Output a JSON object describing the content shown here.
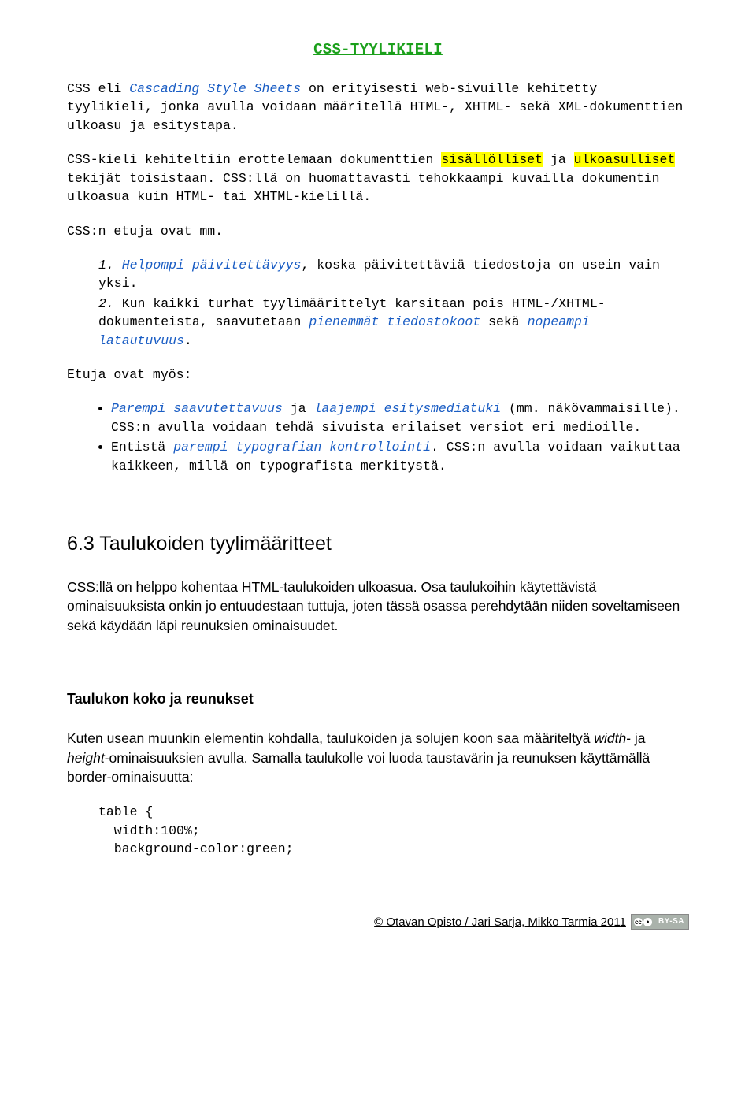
{
  "title": "CSS-TYYLIKIELI",
  "p1": {
    "a": "CSS eli ",
    "b": "Cascading Style Sheets",
    "c": " on erityisesti web-sivuille kehitetty tyylikieli, jonka avulla voidaan määritellä HTML-, XHTML- sekä XML-dokumenttien ulkoasu ja esitystapa."
  },
  "p2": {
    "a": "CSS-kieli kehiteltiin erottelemaan dokumenttien ",
    "b": "sisällölliset",
    "c": " ja ",
    "d": "ulkoasulliset",
    "e": " tekijät toisistaan. CSS:llä on huomattavasti tehokkaampi kuvailla dokumentin ulkoasua kuin HTML- tai XHTML-kielillä."
  },
  "p3": "CSS:n etuja ovat mm.",
  "ol": {
    "n1": "1.",
    "i1a": "Helpompi päivitettävyys",
    "i1b": ", koska päivitettäviä tiedostoja on usein vain yksi.",
    "n2": "2.",
    "i2a": "Kun kaikki turhat tyylimäärittelyt karsitaan pois HTML-/XHTML-dokumenteista, saavutetaan ",
    "i2b": "pienemmät tiedostokoot",
    "i2c": " sekä ",
    "i2d": "nopeampi latautuvuus",
    "i2e": "."
  },
  "p4": "Etuja ovat myös:",
  "ul": {
    "b1a": "Parempi saavutettavuus",
    "b1b": " ja ",
    "b1c": "laajempi esitysmediatuki",
    "b1d": " (mm. näkövammaisille). CSS:n avulla voidaan tehdä sivuista erilaiset versiot eri medioille.",
    "b2a": "Entistä ",
    "b2b": "parempi typografian kontrollointi",
    "b2c": ". CSS:n avulla voidaan vaikuttaa kaikkeen, millä on typografista merkitystä."
  },
  "h2": "6.3 Taulukoiden tyylimääritteet",
  "p5": "CSS:llä on helppo kohentaa HTML-taulukoiden ulkoasua. Osa taulukoihin käytettävistä ominaisuuksista onkin jo entuudestaan tuttuja, joten tässä osassa perehdytään niiden soveltamiseen sekä käydään läpi reunuksien ominaisuudet.",
  "h3": "Taulukon koko ja reunukset",
  "p6": {
    "a": "Kuten usean muunkin elementin kohdalla, taulukoiden ja solujen koon saa määriteltyä ",
    "b": "width",
    "c": "- ja ",
    "d": "height",
    "e": "-ominaisuuksien avulla. Samalla taulukolle voi luoda taustavärin ja reunuksen käyttämällä border-ominaisuutta:"
  },
  "code": "table {\n  width:100%;\n  background-color:green;",
  "footer": {
    "text": "© Otavan Opisto / Jari Sarja, Mikko Tarmia 2011",
    "cc1": "cc",
    "cc2": "●",
    "cc3": "BY-SA"
  }
}
